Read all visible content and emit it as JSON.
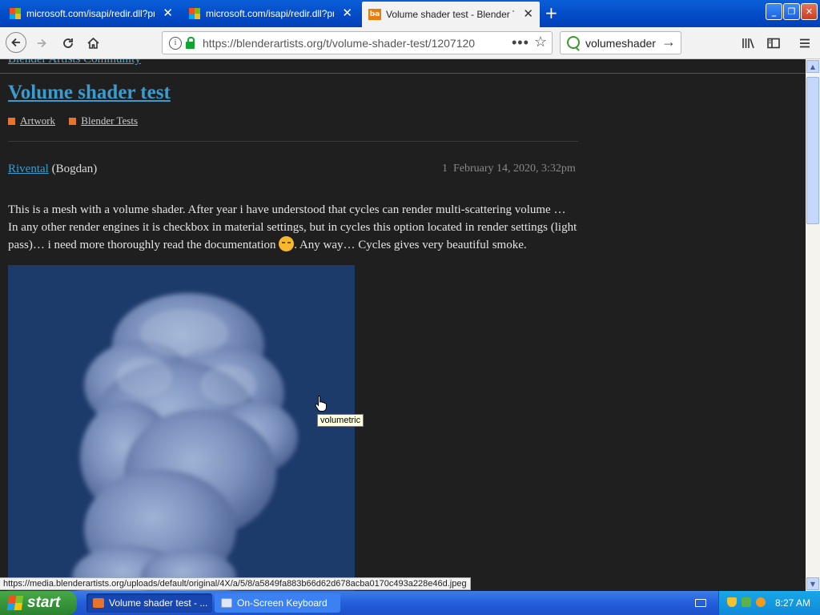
{
  "browser": {
    "tabs": [
      {
        "label": "microsoft.com/isapi/redir.dll?prd=",
        "icon": "microsoft-logo-icon",
        "active": false
      },
      {
        "label": "microsoft.com/isapi/redir.dll?prd=",
        "icon": "microsoft-logo-icon",
        "active": false
      },
      {
        "label": "Volume shader test - Blender Test",
        "icon": "blenderartists-favicon-icon",
        "active": true
      }
    ],
    "favicon_text": "ba",
    "close_glyph": "✕",
    "new_tab_glyph": "+",
    "window_buttons": {
      "minimize": "_",
      "maximize": "❐",
      "close": "✕"
    },
    "address": "https://blenderartists.org/t/volume-shader-test/1207120",
    "search_value": "volumeshader"
  },
  "page": {
    "cutoff_text": "Blender Artists Community",
    "title": "Volume shader test",
    "categories": [
      "Artwork",
      "Blender Tests"
    ],
    "author_username": "Rivental",
    "author_name": "(Bogdan)",
    "post_number": "1",
    "post_date": "February 14, 2020, 3:32pm",
    "body_part1": "This is a mesh with a volume shader. After year i have understood that cycles can render multi-scattering volume … In any other render engines it is checkbox in material settings, but in cycles this option located in render settings (light pass)… i need more thoroughly read the documentation ",
    "body_part2": ". Any way… Cycles gives very beautiful smoke.",
    "tooltip": "volumetric",
    "status_url": "https://media.blenderartists.org/uploads/default/original/4X/a/5/8/a5849fa883b66d62d678acba0170c493a228e46d.jpeg"
  },
  "taskbar": {
    "start_label": "start",
    "items": [
      "Volume shader test - ...",
      "On-Screen Keyboard"
    ],
    "clock": "8:27 AM"
  },
  "colors": {
    "link": "#3a9bcf",
    "category_square": "#e8742a",
    "page_background": "#1f1f1f",
    "image_background": "#1c3a6a"
  }
}
